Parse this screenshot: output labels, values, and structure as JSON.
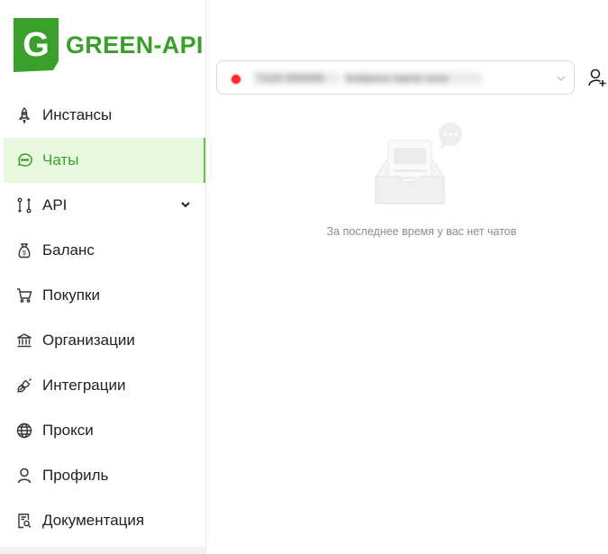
{
  "brand": {
    "logo_letter": "G",
    "name": "GREEN-API",
    "color": "#3ba02b"
  },
  "sidebar": {
    "items": [
      {
        "label": "Инстансы",
        "icon": "rocket-icon",
        "active": false
      },
      {
        "label": "Чаты",
        "icon": "chat-icon",
        "active": true
      },
      {
        "label": "API",
        "icon": "git-compare-icon",
        "active": false,
        "expandable": true
      },
      {
        "label": "Баланс",
        "icon": "money-bag-icon",
        "active": false
      },
      {
        "label": "Покупки",
        "icon": "cart-icon",
        "active": false
      },
      {
        "label": "Организации",
        "icon": "bank-icon",
        "active": false
      },
      {
        "label": "Интеграции",
        "icon": "plug-icon",
        "active": false
      },
      {
        "label": "Прокси",
        "icon": "globe-icon",
        "active": false
      },
      {
        "label": "Профиль",
        "icon": "user-icon",
        "active": false
      },
      {
        "label": "Документация",
        "icon": "document-search-icon",
        "active": false
      }
    ]
  },
  "instance_select": {
    "status": "offline",
    "status_color": "#ff2a2a",
    "value_part_1": "7103 000000",
    "value_part_2": "instance name xxxx"
  },
  "empty_state": {
    "message": "За последнее время у вас нет чатов"
  }
}
